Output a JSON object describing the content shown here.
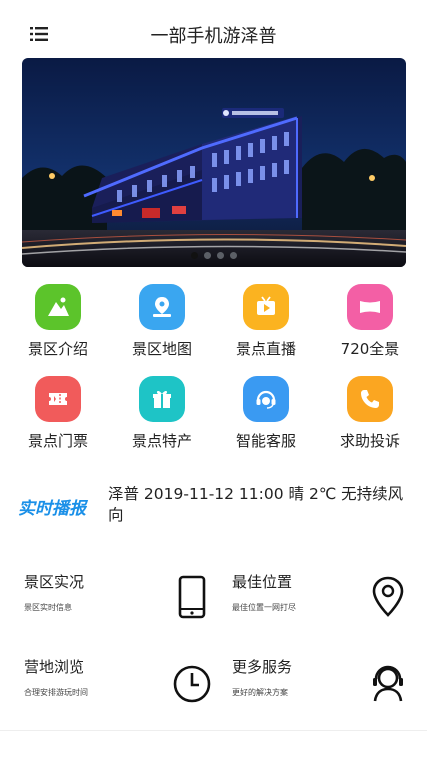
{
  "header": {
    "title": "一部手机游泽普",
    "menu_icon": "list-menu-icon"
  },
  "banner": {
    "description_icon": "banner-photo",
    "active_index": 0,
    "dot_count": 4
  },
  "services": [
    {
      "label": "景区介绍",
      "icon": "mountain-icon",
      "color": "#5cc42b"
    },
    {
      "label": "景区地图",
      "icon": "map-pin-icon",
      "color": "#3aa6f0"
    },
    {
      "label": "景点直播",
      "icon": "play-tv-icon",
      "color": "#fbb320"
    },
    {
      "label": "720全景",
      "icon": "panorama-icon",
      "color": "#f35fa5"
    },
    {
      "label": "景点门票",
      "icon": "ticket-icon",
      "color": "#f15b5b"
    },
    {
      "label": "景点特产",
      "icon": "gift-icon",
      "color": "#1ec4c6"
    },
    {
      "label": "智能客服",
      "icon": "headset-icon",
      "color": "#3a9af2"
    },
    {
      "label": "求助投诉",
      "icon": "phone-icon",
      "color": "#fba621"
    }
  ],
  "news": {
    "logo": "实时播报",
    "text": "泽普 2019-11-12 11:00 晴 2℃ 无持续风向"
  },
  "cards": [
    {
      "title": "景区实况",
      "subtitle": "景区实时信息",
      "icon": "smartphone-icon"
    },
    {
      "title": "最佳位置",
      "subtitle": "最佳位置一网打尽",
      "icon": "location-pin-icon"
    },
    {
      "title": "营地浏览",
      "subtitle": "合理安排游玩时间",
      "icon": "clock-icon"
    },
    {
      "title": "更多服务",
      "subtitle": "更好的解决方案",
      "icon": "support-agent-icon"
    }
  ]
}
